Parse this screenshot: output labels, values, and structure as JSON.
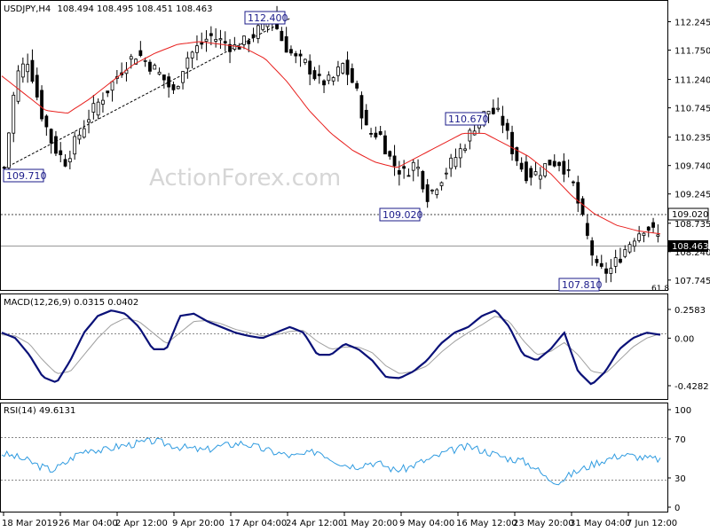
{
  "chart_data": [
    {
      "type": "candlestick",
      "symbol": "USDJPY,H4",
      "ohlc": "108.494 108.495 108.451 108.463",
      "watermark": "ActionForex.com",
      "yticks": [
        "112.245",
        "111.750",
        "111.240",
        "110.745",
        "110.235",
        "109.740",
        "109.245",
        "108.735",
        "108.240",
        "107.745"
      ],
      "ylim": [
        107.65,
        112.5
      ],
      "annotations": [
        {
          "text": "112.400",
          "x": "24 Apr",
          "y": 112.4
        },
        {
          "text": "109.710",
          "x": "18 Mar",
          "y": 109.71
        },
        {
          "text": "110.670",
          "x": "14 May",
          "y": 110.67
        },
        {
          "text": "109.020",
          "x": "8 May",
          "y": 109.02
        },
        {
          "text": "107.810",
          "x": "3 Jun",
          "y": 107.81
        }
      ],
      "hline_price": {
        "label": "109.020",
        "value": 109.02
      },
      "current_price": {
        "label": "108.463",
        "value": 108.463
      },
      "fib_label": "61.8",
      "close_path": [
        109.7,
        111.3,
        111.6,
        110.7,
        110.1,
        109.8,
        110.2,
        110.6,
        110.9,
        111.2,
        111.5,
        111.7,
        111.5,
        111.3,
        111.0,
        111.6,
        111.8,
        112.0,
        111.9,
        111.8,
        111.9,
        112.1,
        112.4,
        111.9,
        111.6,
        111.5,
        111.2,
        111.2,
        111.5,
        111.1,
        110.3,
        110.3,
        109.8,
        109.6,
        109.8,
        109.2,
        109.5,
        109.8,
        110.1,
        110.5,
        110.7,
        110.6,
        110.0,
        109.6,
        109.6,
        109.8,
        109.8,
        109.4,
        108.6,
        107.9,
        107.9,
        108.2,
        108.5,
        108.7,
        108.5
      ],
      "ma_path": [
        111.3,
        111.0,
        110.7,
        110.65,
        110.9,
        111.2,
        111.5,
        111.7,
        111.85,
        111.9,
        111.85,
        111.8,
        111.6,
        111.2,
        110.7,
        110.3,
        110.0,
        109.8,
        109.7,
        109.9,
        110.1,
        110.3,
        110.3,
        110.1,
        109.9,
        109.6,
        109.2,
        108.9,
        108.7,
        108.6,
        108.55
      ]
    },
    {
      "type": "line",
      "title": "MACD(12,26,9) 0.0315 0.0402",
      "yticks": [
        "0.2583",
        "0.00",
        "-0.4282"
      ],
      "ylim": [
        -0.5,
        0.33
      ],
      "macd": [
        0.05,
        0.0,
        -0.15,
        -0.35,
        -0.4,
        -0.2,
        0.05,
        0.2,
        0.25,
        0.22,
        0.1,
        -0.1,
        -0.1,
        0.2,
        0.22,
        0.15,
        0.1,
        0.05,
        0.02,
        0.0,
        0.05,
        0.1,
        0.05,
        -0.15,
        -0.15,
        -0.05,
        -0.1,
        -0.2,
        -0.35,
        -0.36,
        -0.3,
        -0.2,
        -0.05,
        0.05,
        0.1,
        0.2,
        0.25,
        0.1,
        -0.15,
        -0.2,
        -0.1,
        0.05,
        -0.3,
        -0.42,
        -0.3,
        -0.1,
        0.0,
        0.05,
        0.03
      ],
      "signal": [
        0.03,
        0.02,
        -0.05,
        -0.2,
        -0.32,
        -0.3,
        -0.15,
        0.0,
        0.12,
        0.18,
        0.15,
        0.05,
        -0.05,
        0.05,
        0.15,
        0.16,
        0.13,
        0.08,
        0.05,
        0.02,
        0.03,
        0.06,
        0.07,
        -0.03,
        -0.1,
        -0.08,
        -0.08,
        -0.13,
        -0.25,
        -0.32,
        -0.3,
        -0.25,
        -0.13,
        -0.03,
        0.05,
        0.12,
        0.2,
        0.15,
        -0.02,
        -0.15,
        -0.12,
        -0.04,
        -0.15,
        -0.3,
        -0.32,
        -0.2,
        -0.08,
        0.0,
        0.04
      ]
    },
    {
      "type": "line",
      "title": "RSI(14) 49.6131",
      "yticks": [
        "100",
        "70",
        "30",
        "0"
      ],
      "ylim": [
        0,
        100
      ],
      "levels": [
        70,
        30
      ],
      "values": [
        55,
        52,
        48,
        42,
        38,
        45,
        55,
        60,
        58,
        62,
        64,
        66,
        68,
        65,
        62,
        60,
        58,
        62,
        64,
        66,
        62,
        58,
        55,
        52,
        54,
        58,
        50,
        44,
        42,
        46,
        44,
        38,
        40,
        46,
        50,
        56,
        60,
        62,
        58,
        54,
        50,
        48,
        42,
        30,
        26,
        34,
        40,
        46,
        50,
        54,
        52,
        50,
        49
      ]
    }
  ],
  "x_labels": [
    "18 Mar 2019",
    "26 Mar 04:00",
    "2 Apr 12:00",
    "9 Apr 20:00",
    "17 Apr 04:00",
    "24 Apr 12:00",
    "1 May 20:00",
    "9 May 04:00",
    "16 May 12:00",
    "23 May 20:00",
    "31 May 04:00",
    "7 Jun 12:00"
  ],
  "colors": {
    "candle": "#000000",
    "ma": "#e8201e",
    "macd": "#0a1178",
    "signal": "#a0a0a0",
    "rsi": "#2f9be0",
    "annotation_border": "#1b1b8a",
    "grid": "#888888"
  }
}
